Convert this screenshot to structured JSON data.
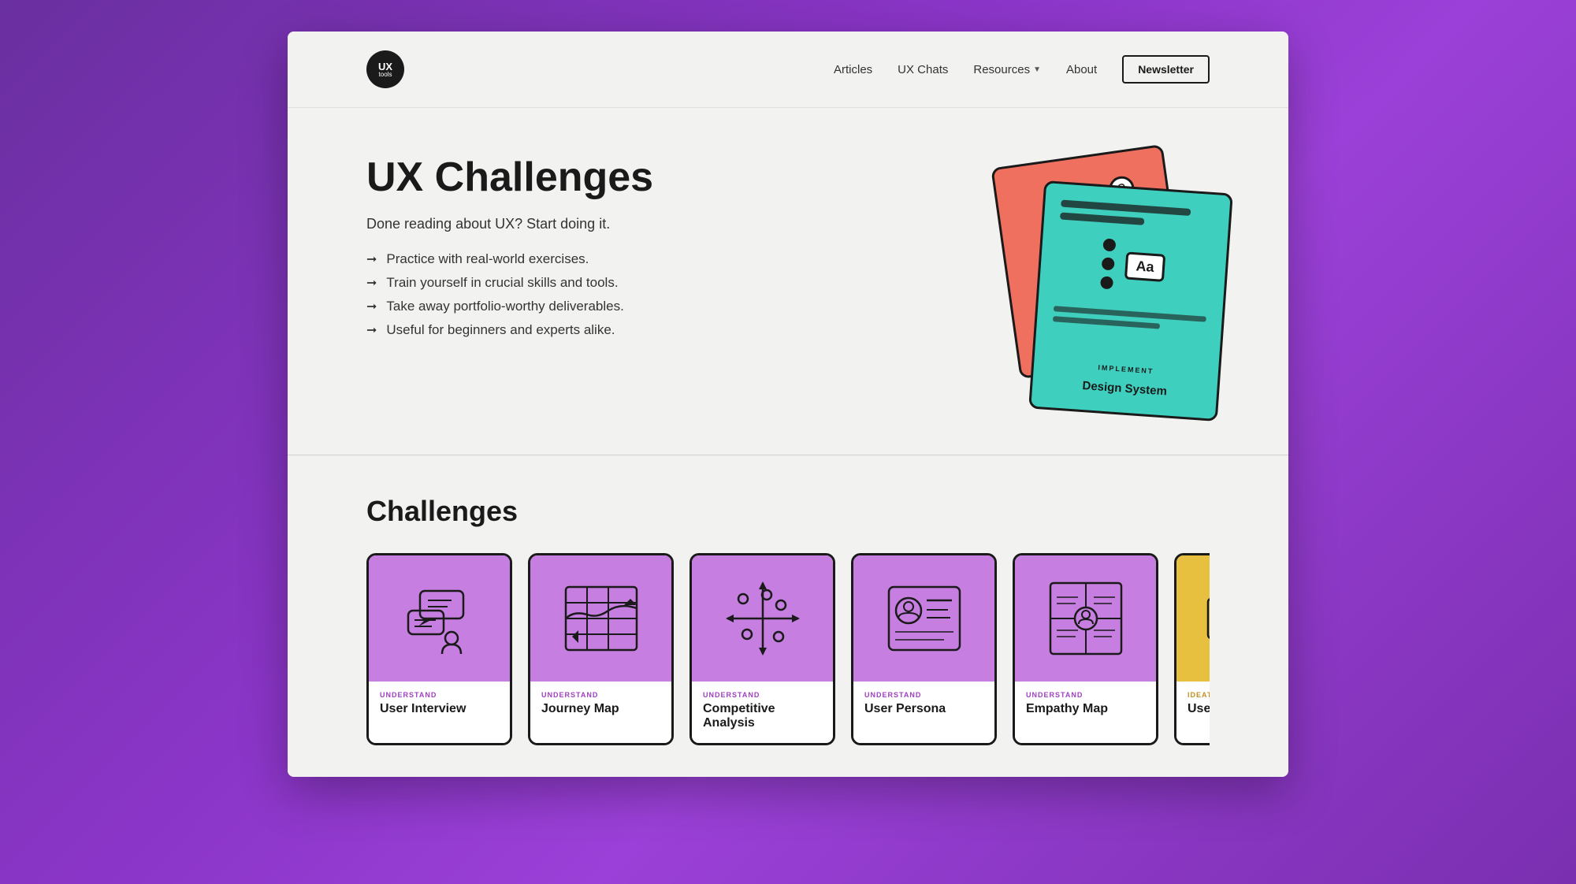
{
  "site": {
    "logo": {
      "ux": "UX",
      "tools": "tools"
    }
  },
  "nav": {
    "links": [
      {
        "id": "articles",
        "label": "Articles"
      },
      {
        "id": "ux-chats",
        "label": "UX Chats"
      },
      {
        "id": "resources",
        "label": "Resources",
        "hasDropdown": true
      },
      {
        "id": "about",
        "label": "About"
      }
    ],
    "newsletter_button": "Newsletter"
  },
  "hero": {
    "title": "UX Challenges",
    "subtitle": "Done reading about UX? Start doing it.",
    "bullets": [
      "Practice with real-world exercises.",
      "Train yourself in crucial skills and tools.",
      "Take away portfolio-worthy deliverables.",
      "Useful for beginners and experts alike."
    ],
    "card_implement_label": "IMPLEMENT",
    "card_design_system": "Design System"
  },
  "challenges": {
    "section_title": "Challenges",
    "cards": [
      {
        "id": "user-interview",
        "tag": "UNDERSTAND",
        "name": "User Interview",
        "color": "purple"
      },
      {
        "id": "journey-map",
        "tag": "UNDERSTAND",
        "name": "Journey Map",
        "color": "purple"
      },
      {
        "id": "competitive-analysis",
        "tag": "UNDERSTAND",
        "name": "Competitive Analysis",
        "color": "purple"
      },
      {
        "id": "user-persona",
        "tag": "UNDERSTAND",
        "name": "User Persona",
        "color": "purple"
      },
      {
        "id": "empathy-map",
        "tag": "UNDERSTAND",
        "name": "Empathy Map",
        "color": "purple"
      },
      {
        "id": "user-flow",
        "tag": "IDEATE",
        "name": "User Flow",
        "color": "yellow"
      }
    ]
  }
}
